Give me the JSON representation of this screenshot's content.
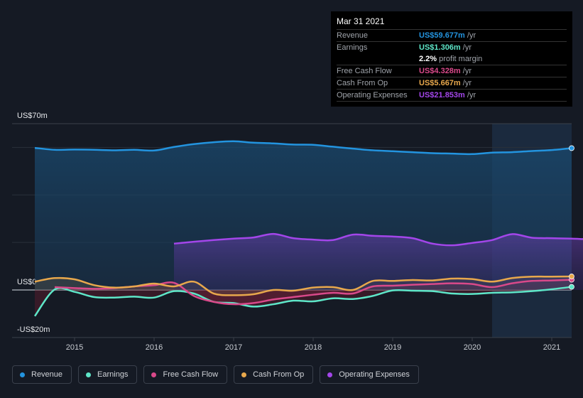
{
  "tooltip": {
    "date": "Mar 31 2021",
    "rows": [
      {
        "label": "Revenue",
        "value": "US$59.677m",
        "unit": "/yr",
        "color": "#2394df"
      },
      {
        "label": "Earnings",
        "value": "US$1.306m",
        "unit": "/yr",
        "color": "#5ee6c8"
      },
      {
        "label": "",
        "value": "2.2%",
        "unit": "profit margin",
        "color": "#ffffff"
      },
      {
        "label": "Free Cash Flow",
        "value": "US$4.328m",
        "unit": "/yr",
        "color": "#d9498a"
      },
      {
        "label": "Cash From Op",
        "value": "US$5.667m",
        "unit": "/yr",
        "color": "#e8a84c"
      },
      {
        "label": "Operating Expenses",
        "value": "US$21.853m",
        "unit": "/yr",
        "color": "#a346ea"
      }
    ]
  },
  "chart_data": {
    "type": "line",
    "ylim": [
      -20,
      70
    ],
    "y_tick_labels": [
      "US$70m",
      "US$0",
      "-US$20m"
    ],
    "x_tick_labels": [
      "2015",
      "2016",
      "2017",
      "2018",
      "2019",
      "2020",
      "2021"
    ],
    "x_ticks": [
      2015,
      2016,
      2017,
      2018,
      2019,
      2020,
      2021
    ],
    "xlim": [
      2014.0,
      2021.25
    ],
    "highlight_range": [
      2020.25,
      2021.25
    ],
    "grid": true,
    "legend_placement": "bottom",
    "series": [
      {
        "name": "Revenue",
        "color": "#2394df",
        "x_start": 2014.5,
        "step": 0.25,
        "values": [
          59.8,
          59.0,
          59.1,
          59.0,
          58.8,
          59.0,
          58.7,
          60.2,
          61.4,
          62.2,
          62.6,
          62.0,
          61.7,
          61.2,
          61.1,
          60.3,
          59.5,
          58.8,
          58.4,
          58.0,
          57.6,
          57.4,
          57.2,
          57.8,
          58.0,
          58.5,
          58.9,
          59.7
        ]
      },
      {
        "name": "Earnings",
        "color": "#5ee6c8",
        "x_start": 2014.5,
        "step": 0.25,
        "values": [
          -11,
          0.2,
          -0.8,
          -3,
          -3.2,
          -2.8,
          -3.2,
          -0.5,
          -1.5,
          -5,
          -5.5,
          -7,
          -6,
          -4.5,
          -4.8,
          -3.5,
          -3.8,
          -2.5,
          -0.2,
          -0.3,
          -0.5,
          -1.5,
          -1.7,
          -1.2,
          -1.0,
          -0.5,
          0.3,
          1.3
        ]
      },
      {
        "name": "Free Cash Flow",
        "color": "#d9498a",
        "x_start": 2014.75,
        "step": 0.25,
        "values": [
          1.2,
          0.8,
          0.5,
          0.8,
          1.5,
          2.0,
          3.0,
          -2.5,
          -5,
          -6,
          -5.5,
          -4,
          -3,
          -2,
          -1.2,
          -1.5,
          1.5,
          1.8,
          2.2,
          2.5,
          2.8,
          2.5,
          1.2,
          2.8,
          3.8,
          4.0,
          4.3
        ]
      },
      {
        "name": "Cash From Op",
        "color": "#e8a84c",
        "x_start": 2014.5,
        "step": 0.25,
        "values": [
          3.5,
          5.0,
          4.5,
          2.0,
          1.0,
          1.5,
          2.7,
          1.5,
          3.5,
          -1.5,
          -2.2,
          -1.8,
          0,
          -0.3,
          1.0,
          1.2,
          0,
          3.8,
          3.8,
          4.2,
          4.0,
          4.8,
          4.6,
          3.5,
          5.0,
          5.6,
          5.6,
          5.7
        ]
      },
      {
        "name": "Operating Expenses",
        "color": "#a346ea",
        "x_start": 2016.25,
        "step": 0.25,
        "values": [
          19.5,
          20.3,
          21.0,
          21.6,
          22.1,
          23.6,
          21.8,
          21.2,
          21.0,
          23.3,
          22.8,
          22.5,
          21.8,
          19.5,
          18.8,
          19.8,
          21.0,
          23.5,
          22.0,
          21.8,
          21.6,
          21.3,
          21.3,
          21.9
        ]
      }
    ]
  }
}
